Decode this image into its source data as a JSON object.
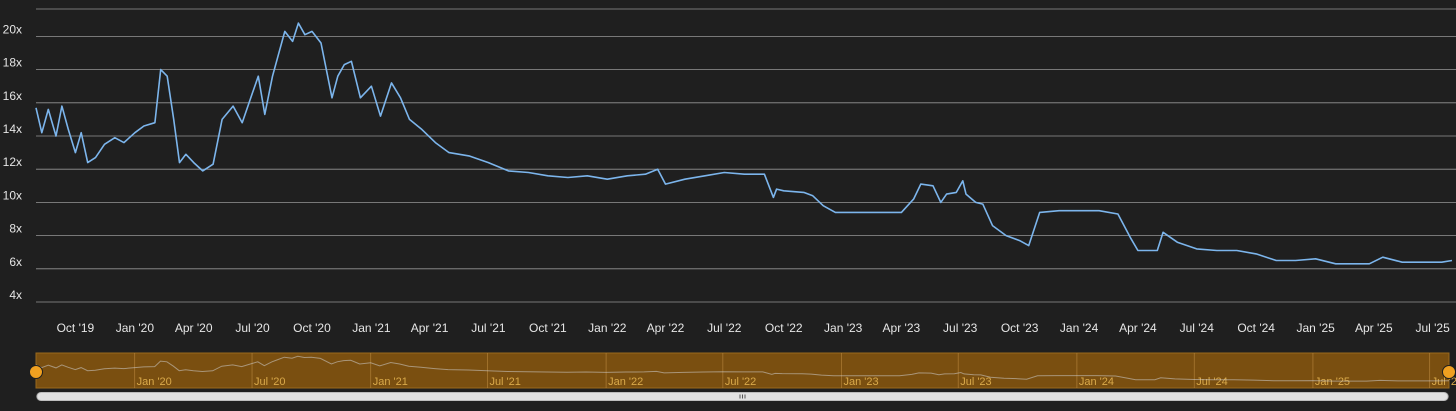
{
  "chart_data": {
    "type": "line",
    "title": "",
    "xlabel": "",
    "ylabel": "",
    "ylim": [
      4,
      21
    ],
    "y_ticks": [
      "4x",
      "6x",
      "8x",
      "10x",
      "12x",
      "14x",
      "16x",
      "18x",
      "20x"
    ],
    "x_ticks": [
      "Oct '19",
      "Jan '20",
      "Apr '20",
      "Jul '20",
      "Oct '20",
      "Jan '21",
      "Apr '21",
      "Jul '21",
      "Oct '21",
      "Jan '22",
      "Apr '22",
      "Jul '22",
      "Oct '22",
      "Jan '23",
      "Apr '23",
      "Jul '23",
      "Oct '23",
      "Jan '24",
      "Apr '24",
      "Jul '24",
      "Oct '24",
      "Jan '25",
      "Apr '25",
      "Jul '25"
    ],
    "x_range": [
      "2019-08-01",
      "2025-07-31"
    ],
    "grid": "horizontal",
    "legend": "none",
    "colors": {
      "line": "#7cb5ec",
      "navigator_fill": "#7a4f10",
      "navigator_handle": "#f0a020",
      "background": "#1f1f1f"
    },
    "series": [
      {
        "x": [
          "2019-08-01",
          "2019-08-10",
          "2019-08-20",
          "2019-09-01",
          "2019-09-10",
          "2019-09-20",
          "2019-10-01",
          "2019-10-10",
          "2019-10-20",
          "2019-11-01",
          "2019-11-15",
          "2019-12-01",
          "2019-12-15",
          "2020-01-01",
          "2020-01-15",
          "2020-02-01",
          "2020-02-10",
          "2020-02-20",
          "2020-03-01",
          "2020-03-10",
          "2020-03-20",
          "2020-04-01",
          "2020-04-15",
          "2020-05-01",
          "2020-05-15",
          "2020-06-01",
          "2020-06-15",
          "2020-07-01",
          "2020-07-10",
          "2020-07-20",
          "2020-08-01",
          "2020-08-10",
          "2020-08-20",
          "2020-09-01",
          "2020-09-10",
          "2020-09-20",
          "2020-10-01",
          "2020-10-15",
          "2020-11-01",
          "2020-11-10",
          "2020-11-20",
          "2020-12-01",
          "2020-12-15",
          "2021-01-01",
          "2021-01-15",
          "2021-02-01",
          "2021-02-15",
          "2021-03-01",
          "2021-03-20",
          "2021-04-10",
          "2021-05-01",
          "2021-06-01",
          "2021-07-01",
          "2021-08-01",
          "2021-09-01",
          "2021-10-01",
          "2021-11-01",
          "2021-12-01",
          "2022-01-01",
          "2022-02-01",
          "2022-03-01",
          "2022-03-20",
          "2022-04-01",
          "2022-05-01",
          "2022-06-01",
          "2022-07-01",
          "2022-08-01",
          "2022-09-01",
          "2022-09-15",
          "2022-09-20",
          "2022-10-01",
          "2022-11-01",
          "2022-11-15",
          "2022-12-01",
          "2022-12-20",
          "2023-01-15",
          "2023-02-01",
          "2023-03-01",
          "2023-04-01",
          "2023-04-20",
          "2023-05-01",
          "2023-05-20",
          "2023-06-01",
          "2023-06-10",
          "2023-06-25",
          "2023-07-05",
          "2023-07-10",
          "2023-07-25",
          "2023-08-05",
          "2023-08-20",
          "2023-09-10",
          "2023-10-01",
          "2023-10-15",
          "2023-11-01",
          "2023-12-01",
          "2024-01-01",
          "2024-02-01",
          "2024-03-01",
          "2024-03-20",
          "2024-04-01",
          "2024-05-01",
          "2024-05-10",
          "2024-06-01",
          "2024-07-01",
          "2024-08-01",
          "2024-09-01",
          "2024-10-01",
          "2024-11-01",
          "2024-12-01",
          "2025-01-01",
          "2025-02-01",
          "2025-03-01",
          "2025-03-25",
          "2025-04-15",
          "2025-05-15",
          "2025-06-15",
          "2025-07-15",
          "2025-07-31"
        ],
        "y": [
          15.7,
          14.2,
          15.6,
          14.0,
          15.8,
          14.4,
          13.0,
          14.2,
          12.4,
          12.7,
          13.5,
          13.9,
          13.6,
          14.2,
          14.6,
          14.8,
          18.0,
          17.6,
          15.0,
          12.4,
          12.9,
          12.4,
          11.9,
          12.3,
          15.0,
          15.8,
          14.8,
          16.6,
          17.6,
          15.3,
          17.6,
          18.9,
          20.3,
          19.7,
          20.8,
          20.1,
          20.3,
          19.6,
          16.3,
          17.6,
          18.3,
          18.5,
          16.3,
          17.0,
          15.2,
          17.2,
          16.3,
          15.0,
          14.4,
          13.6,
          13.0,
          12.8,
          12.4,
          11.9,
          11.8,
          11.6,
          11.5,
          11.6,
          11.4,
          11.6,
          11.7,
          12.0,
          11.1,
          11.4,
          11.6,
          11.8,
          11.7,
          11.7,
          10.3,
          10.8,
          10.7,
          10.6,
          10.4,
          9.8,
          9.4,
          9.4,
          9.4,
          9.4,
          9.4,
          10.2,
          11.1,
          11.0,
          10.0,
          10.5,
          10.6,
          11.3,
          10.5,
          10.0,
          9.9,
          8.6,
          8.0,
          7.7,
          7.4,
          9.4,
          9.5,
          9.5,
          9.5,
          9.3,
          7.9,
          7.1,
          7.1,
          8.2,
          7.6,
          7.2,
          7.1,
          7.1,
          6.9,
          6.5,
          6.5,
          6.6,
          6.3,
          6.3,
          6.3,
          6.7,
          6.4,
          6.4,
          6.4,
          6.5
        ]
      }
    ]
  }
}
